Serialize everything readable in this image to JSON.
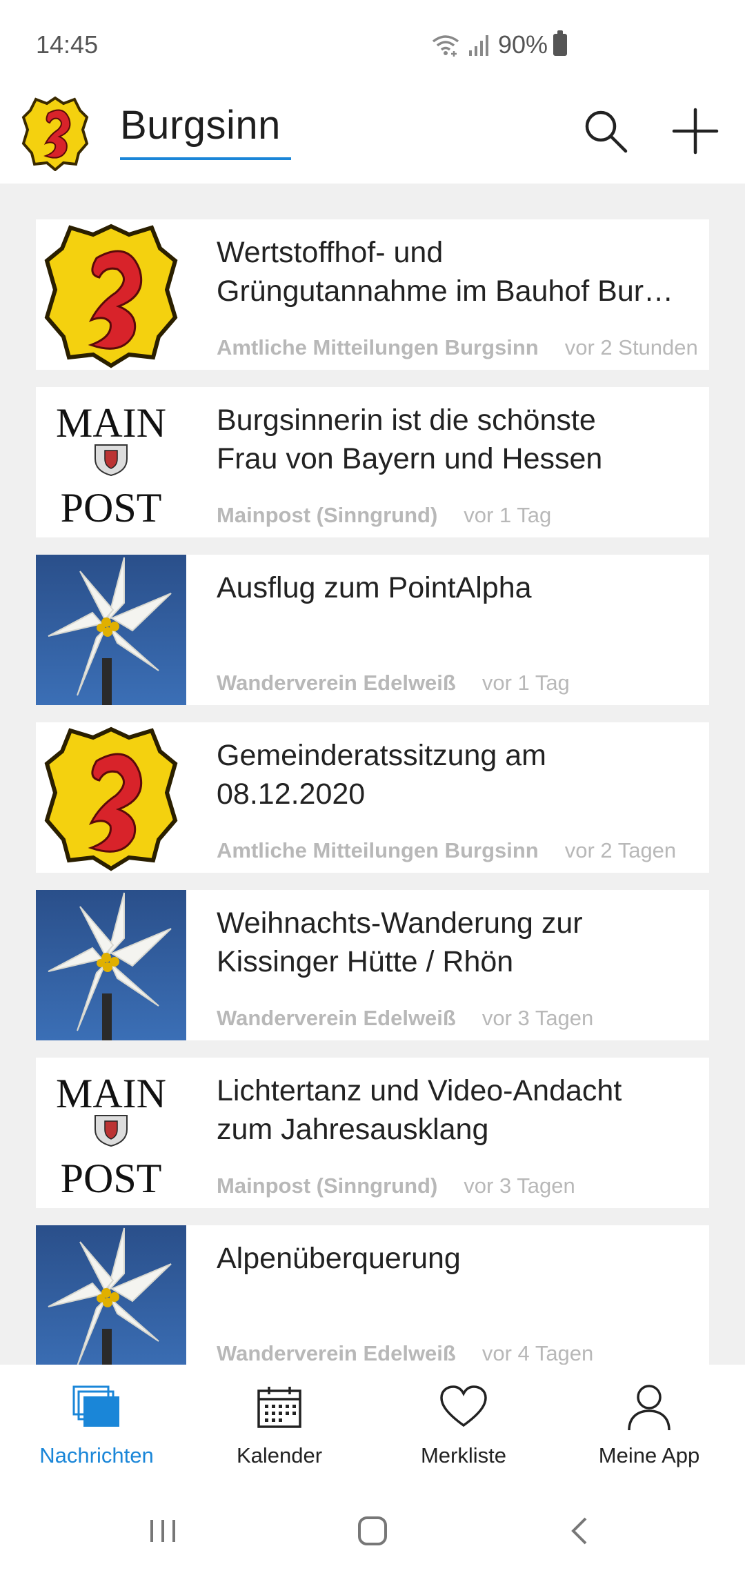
{
  "status_bar": {
    "time": "14:45",
    "battery": "90%"
  },
  "app_bar": {
    "title": "Burgsinn"
  },
  "news": [
    {
      "title": "Wertstoffhof- und Grüngutannahme im Bauhof Bur…",
      "title_line1": "Wertstoffhof- und",
      "title_line2": "Grüngutannahme im Bauhof Bur…",
      "source": "Amtliche Mitteilungen Burgsinn",
      "time": "vor 2 Stunden",
      "thumbnail": "coat-of-arms"
    },
    {
      "title_line1": "Burgsinnerin ist die schönste",
      "title_line2": "Frau von Bayern und Hessen",
      "source": "Mainpost (Sinngrund)",
      "time": "vor 1 Tag",
      "thumbnail": "mainpost-logo",
      "logo_text_top": "MAIN",
      "logo_text_bottom": "POST"
    },
    {
      "title_line1": "Ausflug zum PointAlpha",
      "title_line2": "",
      "source": "Wanderverein Edelweiß",
      "time": "vor 1 Tag",
      "thumbnail": "edelweiss"
    },
    {
      "title_line1": "Gemeinderatssitzung am",
      "title_line2": "08.12.2020",
      "source": "Amtliche Mitteilungen Burgsinn",
      "time": "vor 2 Tagen",
      "thumbnail": "coat-of-arms"
    },
    {
      "title_line1": "Weihnachts-Wanderung zur",
      "title_line2": "Kissinger Hütte / Rhön",
      "source": "Wanderverein Edelweiß",
      "time": "vor 3 Tagen",
      "thumbnail": "edelweiss"
    },
    {
      "title_line1": "Lichtertanz und Video-Andacht",
      "title_line2": "zum Jahresausklang",
      "source": "Mainpost (Sinngrund)",
      "time": "vor 3 Tagen",
      "thumbnail": "mainpost-logo",
      "logo_text_top": "MAIN",
      "logo_text_bottom": "POST"
    },
    {
      "title_line1": "Alpenüberquerung",
      "title_line2": "",
      "source": "Wanderverein Edelweiß",
      "time": "vor 4 Tagen",
      "thumbnail": "edelweiss"
    }
  ],
  "bottom_nav": [
    {
      "label": "Nachrichten",
      "icon": "news-stack-icon",
      "active": true
    },
    {
      "label": "Kalender",
      "icon": "calendar-icon",
      "active": false
    },
    {
      "label": "Merkliste",
      "icon": "heart-icon",
      "active": false
    },
    {
      "label": "Meine App",
      "icon": "user-icon",
      "active": false
    }
  ],
  "colors": {
    "accent": "#1a86d8",
    "meta_text": "#b8b8b8",
    "background": "#f0f0f0",
    "edelweiss_sky": "#2f5f9e",
    "arms_yellow": "#f4d10f",
    "arms_red": "#d8232a"
  }
}
